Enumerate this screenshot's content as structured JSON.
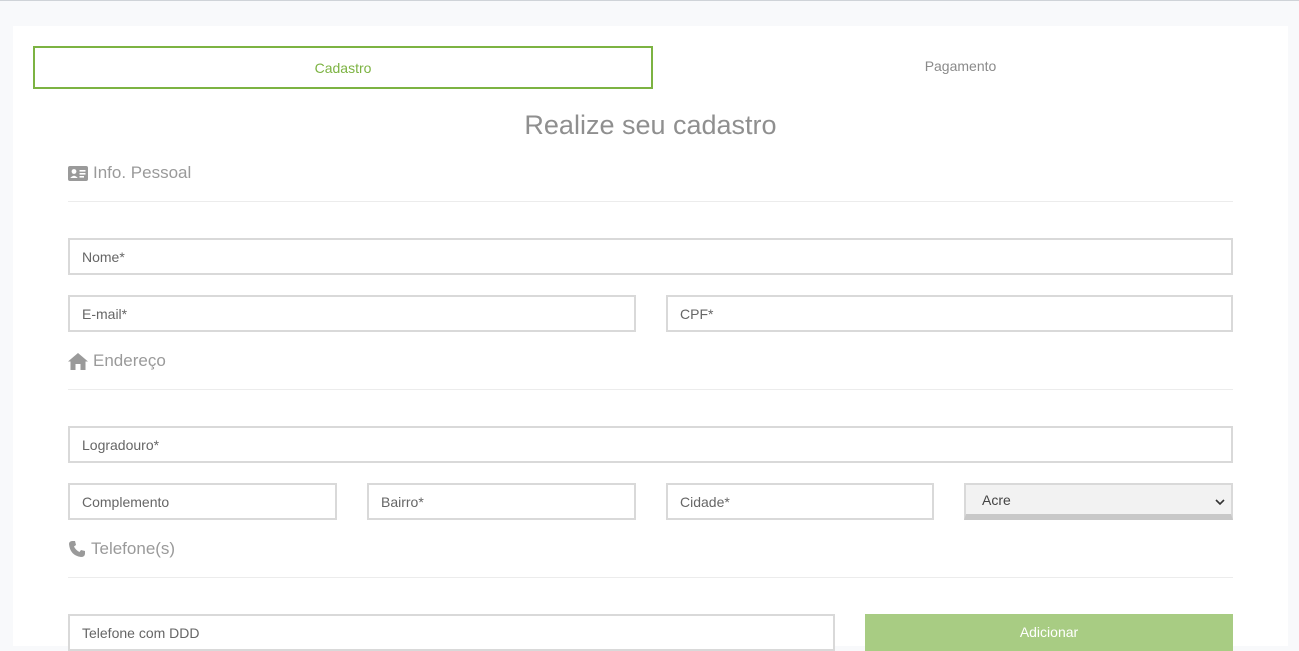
{
  "tabs": [
    {
      "label": "Cadastro",
      "active": true
    },
    {
      "label": "Pagamento",
      "active": false
    }
  ],
  "page_title": "Realize seu cadastro",
  "sections": {
    "personal": {
      "title": "Info. Pessoal",
      "icon": "id-card-icon"
    },
    "address": {
      "title": "Endereço",
      "icon": "home-icon"
    },
    "phone": {
      "title": "Telefone(s)",
      "icon": "phone-icon"
    }
  },
  "fields": {
    "nome": {
      "placeholder": "Nome*",
      "value": ""
    },
    "email": {
      "placeholder": "E-mail*",
      "value": ""
    },
    "cpf": {
      "placeholder": "CPF*",
      "value": ""
    },
    "logradouro": {
      "placeholder": "Logradouro*",
      "value": ""
    },
    "complemento": {
      "placeholder": "Complemento",
      "value": ""
    },
    "bairro": {
      "placeholder": "Bairro*",
      "value": ""
    },
    "cidade": {
      "placeholder": "Cidade*",
      "value": ""
    },
    "telefone": {
      "placeholder": "Telefone com DDD",
      "value": ""
    }
  },
  "estado_select": {
    "selected": "Acre"
  },
  "add_button_label": "Adicionar",
  "colors": {
    "accent": "#7cb342",
    "button": "#a8cc83",
    "text_muted": "#8f8f8f"
  }
}
